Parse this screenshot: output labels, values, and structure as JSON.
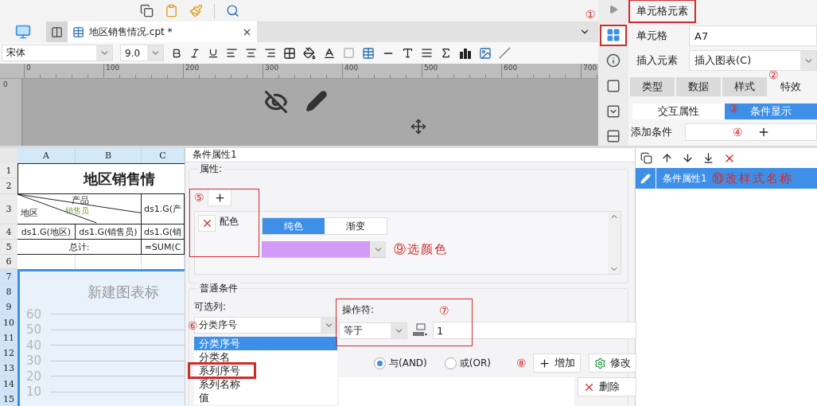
{
  "editor": {
    "tab": {
      "title": "地区销售情况.cpt *"
    },
    "font_family": "宋体",
    "font_size": "9.0",
    "ruler_ticks": [
      "0",
      "100",
      "200",
      "300",
      "400",
      "500",
      "600",
      "700"
    ],
    "vertical_ruler": "0"
  },
  "sheet": {
    "columns": [
      "A",
      "B",
      "C"
    ],
    "rows": [
      {
        "label": "1",
        "selected": false
      },
      {
        "label": "2",
        "selected": false
      },
      {
        "label": "3",
        "selected": false
      },
      {
        "label": "4",
        "selected": false
      },
      {
        "label": "5",
        "selected": false
      },
      {
        "label": "6",
        "selected": false
      },
      {
        "label": "7",
        "selected": true
      },
      {
        "label": "8",
        "selected": true
      },
      {
        "label": "9",
        "selected": true
      },
      {
        "label": "10",
        "selected": true
      },
      {
        "label": "11",
        "selected": true
      },
      {
        "label": "12",
        "selected": true
      },
      {
        "label": "13",
        "selected": true
      },
      {
        "label": "14",
        "selected": true
      },
      {
        "label": "15",
        "selected": true
      }
    ],
    "title": "地区销售情",
    "corner": {
      "top": "产品",
      "middle": "销售员",
      "left": "地区"
    },
    "c3": "ds1.G(产",
    "row4": [
      "ds1.G(地区)",
      "ds1.G(销售员)",
      "ds1.G(销"
    ],
    "total_label": "总计:",
    "total_formula": "=SUM(C",
    "chart": {
      "title": "新建图表标",
      "yticks": [
        "60",
        "50",
        "40",
        "30",
        "20",
        "10"
      ]
    }
  },
  "side_panel": {
    "header": {
      "title": "单元格元素",
      "highlighted": true,
      "annotation": "①"
    },
    "strip": [
      {
        "kind": "cell",
        "selected": true,
        "highlighted": true
      },
      {
        "kind": "info",
        "selected": false,
        "highlighted": false
      },
      {
        "kind": "frame",
        "selected": false,
        "highlighted": false
      },
      {
        "kind": "widget",
        "selected": false,
        "highlighted": false
      },
      {
        "kind": "float",
        "selected": false,
        "highlighted": false
      }
    ],
    "cell_label": "单元格",
    "cell_value": "A7",
    "insert_label": "插入元素",
    "insert_value": "插入图表(C)",
    "tabs": [
      {
        "label": "类型",
        "selected": false
      },
      {
        "label": "数据",
        "selected": false
      },
      {
        "label": "样式",
        "selected": false
      },
      {
        "label": "特效",
        "selected": true
      }
    ],
    "tabs_annotation": "②",
    "subtabs": [
      {
        "label": "交互属性",
        "selected": false
      },
      {
        "label": "条件显示",
        "selected": true
      }
    ],
    "subtabs_annotation": "③",
    "add_label": "添加条件",
    "add_annotation": "④"
  },
  "conditions": {
    "items": [
      {
        "name": "条件属性1",
        "selected": true
      }
    ],
    "annotation": "⑩改样式名称"
  },
  "dialog": {
    "title": "条件属性1",
    "attributes": {
      "label": "属性:",
      "annotation": "⑤",
      "highlighted": true,
      "items": [
        {
          "name": "配色"
        }
      ],
      "fill_modes": [
        {
          "label": "纯色",
          "selected": true
        },
        {
          "label": "渐变",
          "selected": false
        }
      ],
      "color": "#d29bf7",
      "color_annotation": "⑨选颜色"
    },
    "normal": {
      "title": "普通条件",
      "column_label": "可选列:",
      "column_annotation": "⑥",
      "column_value": "分类序号",
      "options": [
        {
          "label": "分类序号",
          "selected": true,
          "highlighted": false
        },
        {
          "label": "分类名",
          "selected": false,
          "highlighted": false
        },
        {
          "label": "系列序号",
          "selected": false,
          "highlighted": true
        },
        {
          "label": "系列名称",
          "selected": false,
          "highlighted": false
        },
        {
          "label": "值",
          "selected": false,
          "highlighted": false
        }
      ],
      "operator": {
        "label": "操作符:",
        "annotation": "⑦",
        "highlighted": true,
        "value": "等于",
        "operand": "1"
      },
      "logic": [
        {
          "label": "与(AND)",
          "selected": true
        },
        {
          "label": "或(OR)",
          "selected": false
        }
      ],
      "annotation": "⑧",
      "buttons": [
        {
          "kind": "add",
          "label": "增加"
        },
        {
          "kind": "edit",
          "label": "修改"
        }
      ],
      "delete": "删除"
    }
  }
}
